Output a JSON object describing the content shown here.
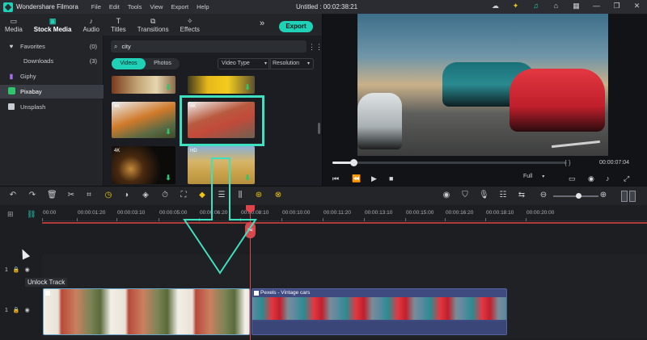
{
  "app": {
    "name": "Wondershare Filmora",
    "menu": [
      "File",
      "Edit",
      "Tools",
      "View",
      "Export",
      "Help"
    ],
    "document_title": "Untitled : 00:02:38:21"
  },
  "top_tabs": [
    {
      "label": "Media",
      "icon": "folder-icon",
      "active": false
    },
    {
      "label": "Stock Media",
      "icon": "stock-media-icon",
      "active": true
    },
    {
      "label": "Audio",
      "icon": "music-note-icon",
      "active": false
    },
    {
      "label": "Titles",
      "icon": "titles-icon",
      "active": false
    },
    {
      "label": "Transitions",
      "icon": "transitions-icon",
      "active": false
    },
    {
      "label": "Effects",
      "icon": "effects-icon",
      "active": false
    }
  ],
  "export_label": "Export",
  "sidebar": {
    "items": [
      {
        "label": "Favorites",
        "count": "(0)",
        "icon": "heart-icon"
      },
      {
        "label": "Downloads",
        "count": "(3)"
      },
      {
        "label": "Giphy",
        "icon": "giphy-icon"
      },
      {
        "label": "Pixabay",
        "icon": "pixabay-icon",
        "active": true
      },
      {
        "label": "Unsplash",
        "icon": "unsplash-icon"
      }
    ]
  },
  "media": {
    "search_value": "city",
    "tabs": [
      "Videos",
      "Photos"
    ],
    "active_tab": "Videos",
    "filters": [
      "Video Type",
      "Resolution"
    ],
    "thumb_badges": [
      "4K",
      "4K",
      "4K",
      "HD"
    ]
  },
  "player": {
    "timecode": "00:00:07:04",
    "quality": "Full",
    "progress": 0.08,
    "brackets": "{   }"
  },
  "timeline": {
    "ticks": [
      "00:00",
      "00:00:01:20",
      "00:00:03:10",
      "00:00:05:00",
      "00:00:06:20",
      "00:00:08:10",
      "00:00:10:00",
      "00:00:11:20",
      "00:00:13:10",
      "00:00:15:00",
      "00:00:16:20",
      "00:00:18:10",
      "00:00:20:00"
    ],
    "tooltip": "Unlock Track",
    "track_labels": [
      "1",
      "1"
    ],
    "clip2_label": "Pexels - Vintage cars"
  },
  "colors": {
    "accent": "#1fd1b6",
    "playhead": "#e0434b",
    "highlight": "#3ee0bf"
  }
}
